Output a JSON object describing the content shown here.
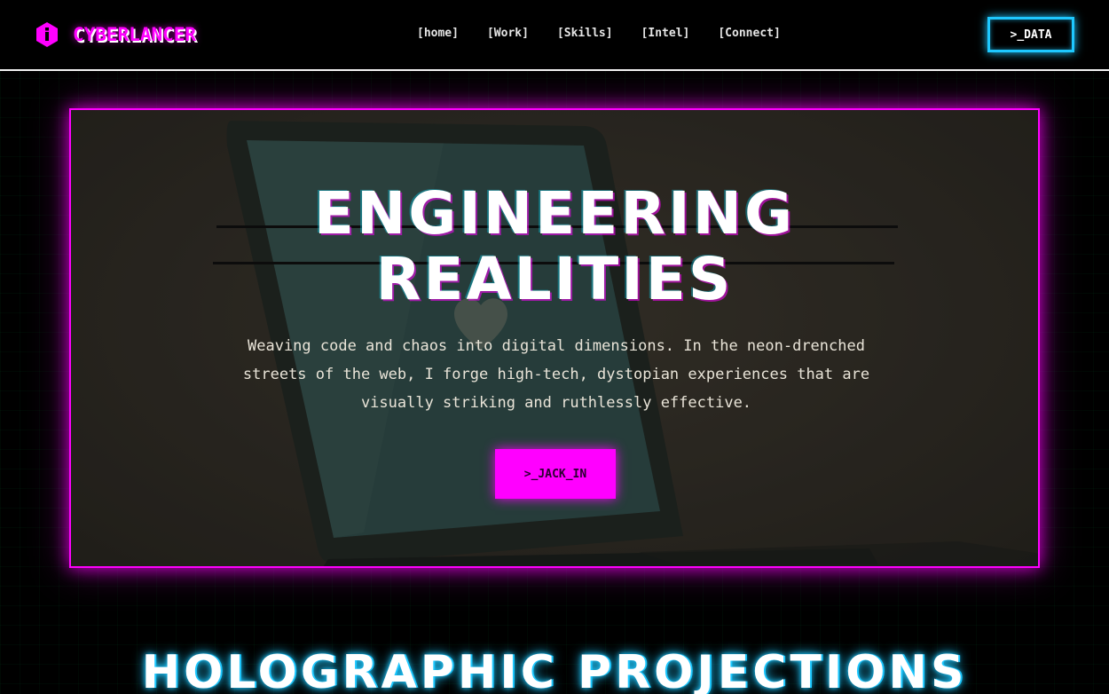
{
  "brand": {
    "logo_icon": "hexagon-info-icon",
    "name": "CYBERLANCER"
  },
  "nav": {
    "items": [
      {
        "label": "[home]"
      },
      {
        "label": "[Work]"
      },
      {
        "label": "[Skills]"
      },
      {
        "label": "[Intel]"
      },
      {
        "label": "[Connect]"
      }
    ],
    "cta_label": ">_DATA"
  },
  "hero": {
    "title_line1": "ENGINEERING",
    "title_line2": "REALITIES",
    "description": "Weaving code and chaos into digital dimensions. In the neon-drenched streets of the web, I forge high-tech, dystopian experiences that are visually striking and ruthlessly effective.",
    "button_label": ">_JACK_IN",
    "background_image": "laptop-photo"
  },
  "sections": {
    "projects_title": "HOLOGRAPHIC PROJECTIONS"
  },
  "colors": {
    "accent_magenta": "#ff00ff",
    "accent_cyan": "#1ec8ff",
    "background": "#000000"
  }
}
